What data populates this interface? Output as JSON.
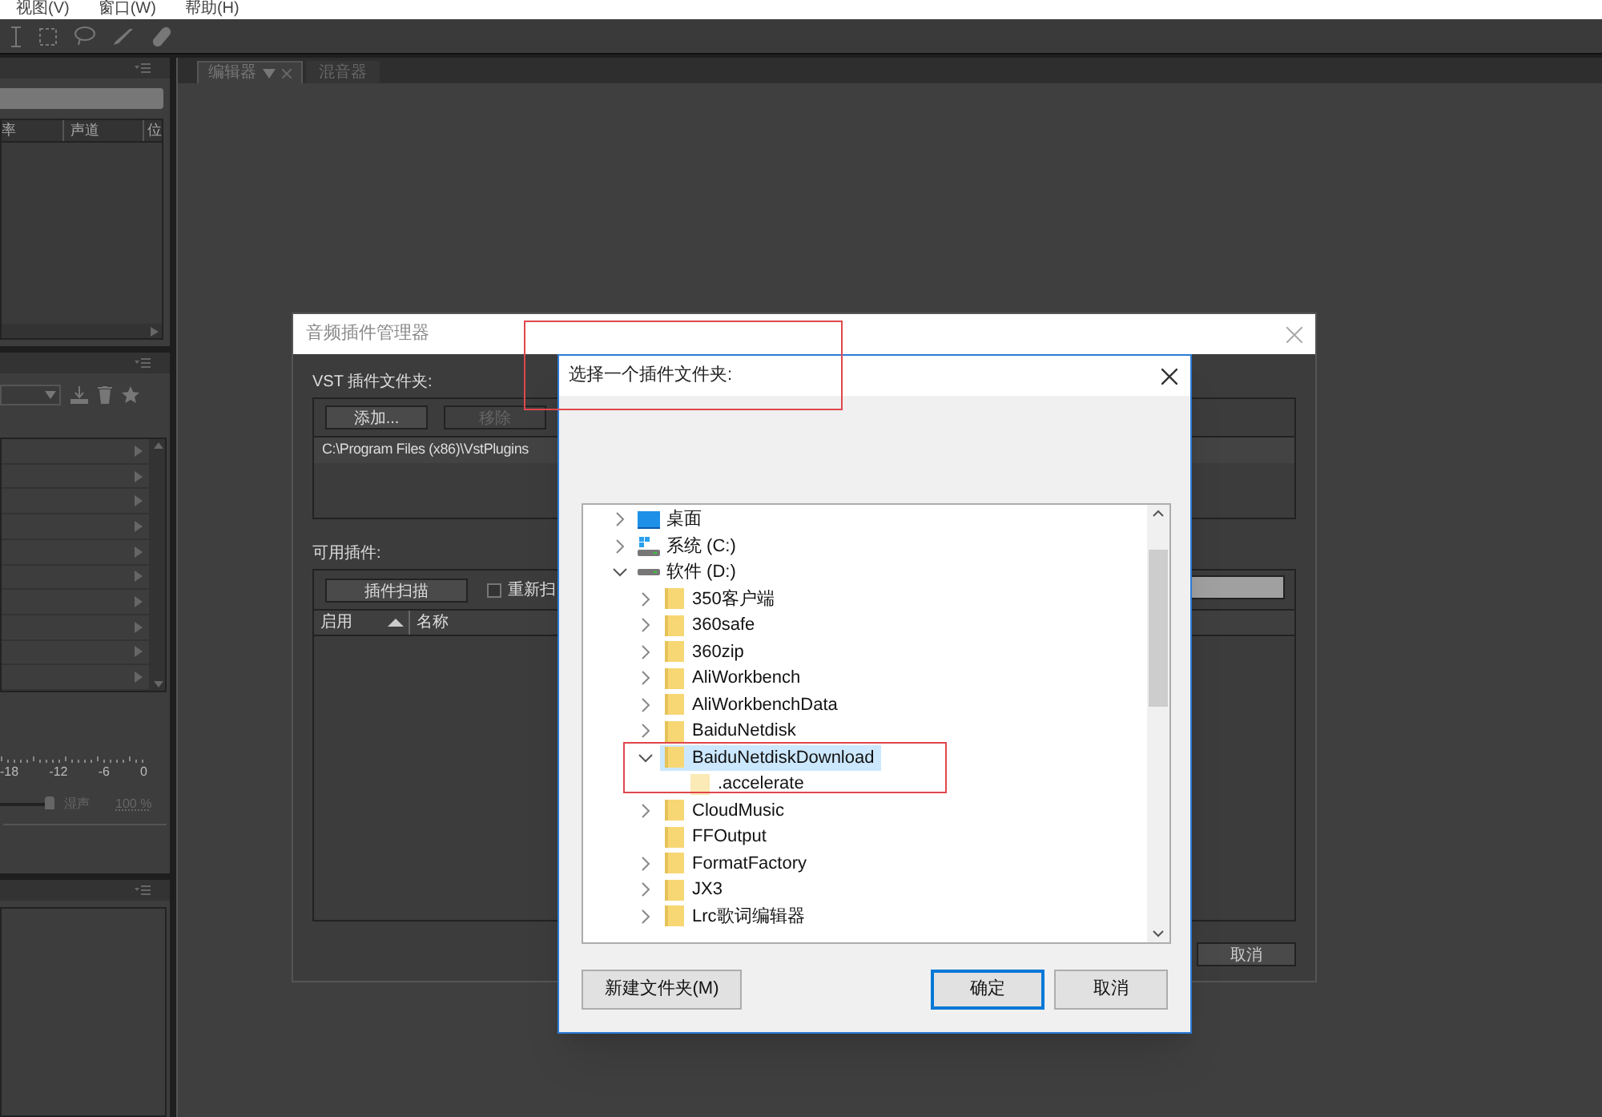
{
  "menu_bar": [
    "视图(V)",
    "窗口(W)",
    "帮助(H)"
  ],
  "editor_tabs": [
    {
      "label": "编辑器",
      "selected": true
    },
    {
      "label": "混音器",
      "selected": false
    }
  ],
  "files_panel": {
    "columns": [
      "率",
      "声道",
      "位"
    ]
  },
  "effects_panel": {
    "meter_scale": [
      "-18",
      "-12",
      "-6",
      "0"
    ],
    "mix_slider": {
      "level": 1
    },
    "mix_label": "湿声",
    "mix_value": "100 %"
  },
  "plugin_manager": {
    "title": "音频插件管理器",
    "vst_label": "VST 插件文件夹:",
    "add_button": {
      "label": "添加...",
      "disabled": false
    },
    "remove_button": {
      "label": "移除",
      "disabled": true
    },
    "folders": [
      "C:\\Program Files (x86)\\VstPlugins"
    ],
    "available_label": "可用插件:",
    "scan_button": "插件扫描",
    "rescan": {
      "label": "重新扫",
      "checked": false
    },
    "scan_progress": {
      "level": 1
    },
    "columns": [
      {
        "label": "启用",
        "sorted": true
      },
      {
        "label": "名称",
        "sorted": false
      }
    ],
    "cancel_button": "取消"
  },
  "folder_dialog": {
    "title": "选择一个插件文件夹:",
    "tree": [
      {
        "label": "桌面",
        "kind": "desktop",
        "expanded": false,
        "selected": false
      },
      {
        "label": "系统 (C:)",
        "kind": "system",
        "expanded": false,
        "selected": false
      },
      {
        "label": "软件 (D:)",
        "kind": "drive",
        "expanded": true,
        "selected": false,
        "children": [
          {
            "label": "350客户端",
            "kind": "folder",
            "expanded": false,
            "selected": false
          },
          {
            "label": "360safe",
            "kind": "folder",
            "expanded": false,
            "selected": false
          },
          {
            "label": "360zip",
            "kind": "folder",
            "expanded": false,
            "selected": false
          },
          {
            "label": "AliWorkbench",
            "kind": "folder",
            "expanded": false,
            "selected": false
          },
          {
            "label": "AliWorkbenchData",
            "kind": "folder",
            "expanded": false,
            "selected": false
          },
          {
            "label": "BaiduNetdisk",
            "kind": "folder",
            "expanded": false,
            "selected": false
          },
          {
            "label": "BaiduNetdiskDownload",
            "kind": "folder",
            "expanded": true,
            "selected": true,
            "children": [
              {
                "label": ".accelerate",
                "kind": "hidden",
                "selected": false
              }
            ]
          },
          {
            "label": "CloudMusic",
            "kind": "folder",
            "expanded": false,
            "selected": false
          },
          {
            "label": "FFOutput",
            "kind": "folder",
            "selected": false
          },
          {
            "label": "FormatFactory",
            "kind": "folder",
            "expanded": false,
            "selected": false
          },
          {
            "label": "JX3",
            "kind": "folder",
            "expanded": false,
            "selected": false
          },
          {
            "label": "Lrc歌词编辑器",
            "kind": "folder",
            "expanded": false,
            "selected": false
          }
        ]
      }
    ],
    "new_folder_button": "新建文件夹(M)",
    "ok_button": "确定",
    "cancel_button": "取消"
  }
}
